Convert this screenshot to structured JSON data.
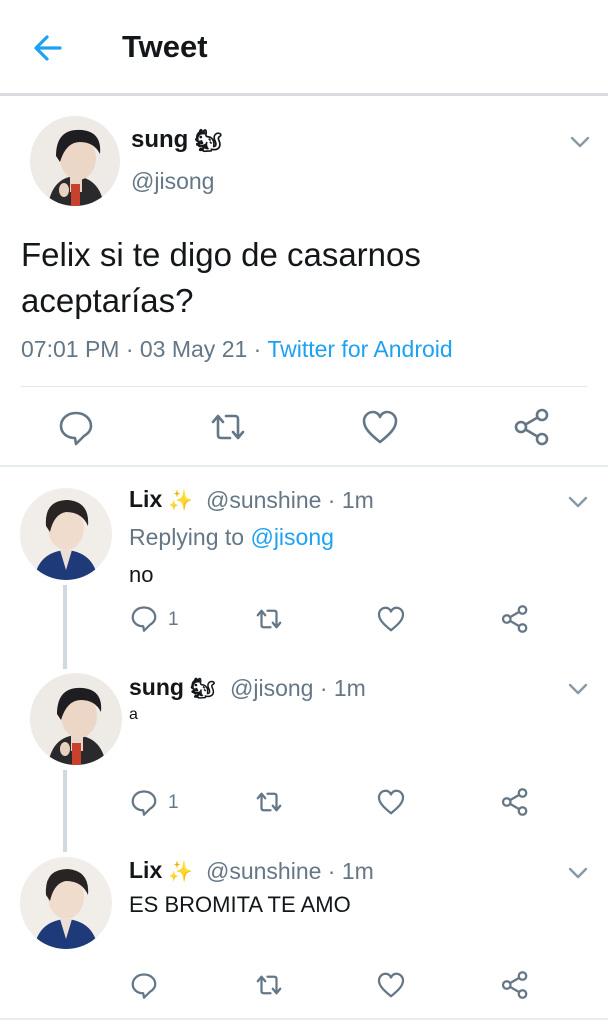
{
  "header": {
    "title": "Tweet",
    "back_icon": "arrow-left-icon"
  },
  "colors": {
    "accent": "#1da1f2",
    "secondary_text": "#657786",
    "text": "#14171a",
    "divider": "#e6ecf0"
  },
  "tweet": {
    "name": "sung",
    "name_emoji": "🐿",
    "handle": "@jisong",
    "text": "Felix si te digo de casarnos aceptarías?",
    "time": "07:01 PM · 03 May 21 · ",
    "source": "Twitter for Android",
    "actions": [
      "reply-icon",
      "retweet-icon",
      "like-icon",
      "share-icon"
    ]
  },
  "replies": [
    {
      "name": "Lix",
      "name_emoji": "✨",
      "handle": "@sunshine · 1m",
      "replying_prefix": "Replying to ",
      "replying_to": "@jisong",
      "text": "no",
      "reply_count": "1"
    },
    {
      "name": "sung",
      "name_emoji": "🐿",
      "handle": "@jisong · 1m",
      "text": "a",
      "reply_count": "1"
    },
    {
      "name": "Lix",
      "name_emoji": "✨",
      "handle": "@sunshine · 1m",
      "text": "ES BROMITA TE AMO",
      "reply_count": ""
    }
  ]
}
